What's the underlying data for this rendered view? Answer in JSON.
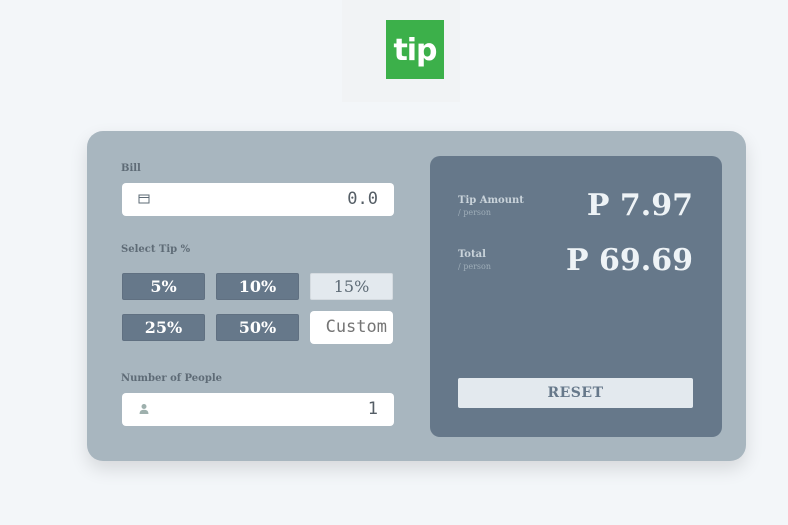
{
  "logo": {
    "text": "tip",
    "color": "#3cb04a"
  },
  "bill": {
    "label": "Bill",
    "value": "0.0",
    "icon": "bill-icon"
  },
  "tip": {
    "label": "Select Tip %",
    "options": [
      "5%",
      "10%",
      "15%",
      "25%",
      "50%"
    ],
    "selected": "15%",
    "custom_placeholder": "Custom"
  },
  "people": {
    "label": "Number of People",
    "value": "1",
    "icon": "person-icon"
  },
  "results": {
    "tip_amount_label": "Tip Amount",
    "tip_amount_sub": "/ person",
    "tip_amount_value": "P 7.97",
    "total_label": "Total",
    "total_sub": "/ person",
    "total_value": "P 69.69",
    "reset_label": "RESET"
  },
  "colors": {
    "card": "#a8b6bf",
    "panel": "#66788a",
    "button": "#66788a",
    "button_active": "#e3e9ee"
  }
}
